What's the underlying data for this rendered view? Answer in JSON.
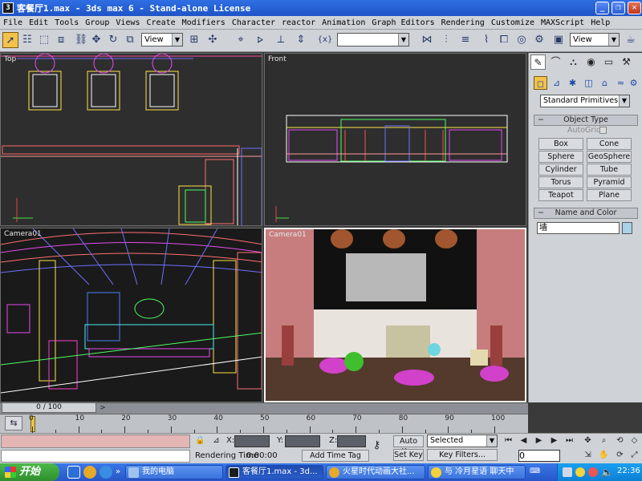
{
  "window": {
    "title": "客餐厅1.max - 3ds max 6 - Stand-alone License",
    "app_icon": "3ds-max-icon",
    "min_label": "_",
    "max_label": "❐",
    "close_label": "✕"
  },
  "menu": [
    "File",
    "Edit",
    "Tools",
    "Group",
    "Views",
    "Create",
    "Modifiers",
    "Character",
    "reactor",
    "Animation",
    "Graph Editors",
    "Rendering",
    "Customize",
    "MAXScript",
    "Help"
  ],
  "toolbar": {
    "view_select_1": "View",
    "view_select_2": "View",
    "named_selection": "",
    "snap_label": "{x}"
  },
  "viewports": {
    "top_label": "Top",
    "front_label": "Front",
    "camera_label": "Camera01",
    "render_label": "Camera01"
  },
  "command_panel": {
    "category": "Standard Primitives",
    "object_type_title": "Object Type",
    "autogrid_label": "AutoGrid",
    "buttons": [
      "Box",
      "Cone",
      "Sphere",
      "GeoSphere",
      "Cylinder",
      "Tube",
      "Torus",
      "Pyramid",
      "Teapot",
      "Plane"
    ],
    "name_color_title": "Name and Color",
    "name_value": "墙",
    "color_swatch": "#a7d3e6"
  },
  "timeline": {
    "frame_readout": "0 / 100",
    "ticks": [
      "0",
      "10",
      "20",
      "30",
      "40",
      "50",
      "60",
      "70",
      "80",
      "90",
      "100"
    ],
    "current_frame": 0,
    "total_frames": 100
  },
  "status": {
    "x_label": "X:",
    "y_label": "Y:",
    "z_label": "Z:",
    "rendering_time_label": "Rendering Time",
    "rendering_time_value": "0:00:00",
    "add_time_tag": "Add Time Tag",
    "auto_key": "Auto Key",
    "set_key": "Set Key",
    "selected": "Selected",
    "key_filters": "Key Filters...",
    "frame_field": "0"
  },
  "taskbar": {
    "start": "开始",
    "items": [
      "我的电脑",
      "客餐厅1.max - 3d...",
      "火星时代动画大社...",
      "与  冷月星语 聊天中"
    ],
    "clock": "22:36"
  }
}
